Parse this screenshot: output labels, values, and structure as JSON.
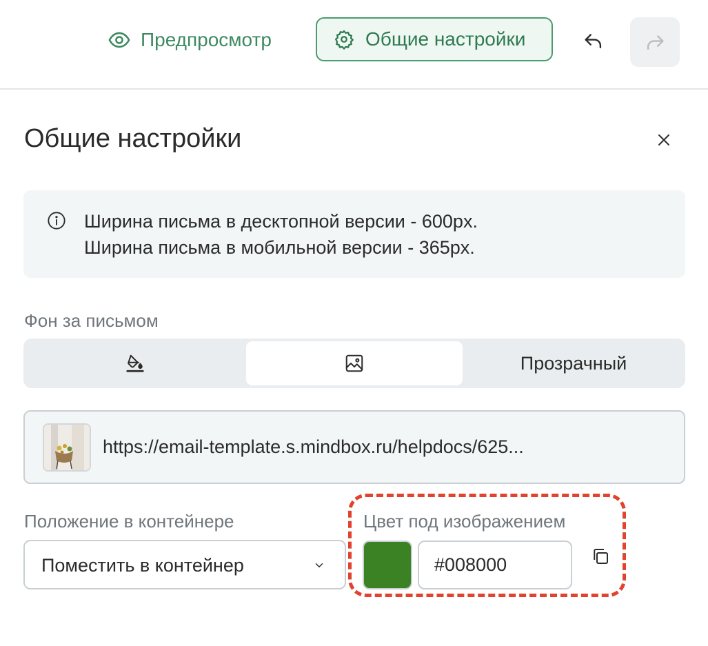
{
  "toolbar": {
    "preview_label": "Предпросмотр",
    "settings_label": "Общие настройки",
    "accent_color": "#3d8a62"
  },
  "panel": {
    "title": "Общие настройки",
    "info": {
      "line1": "Ширина письма в десктопной версии - 600px.",
      "line2": "Ширина письма в мобильной версии - 365px."
    },
    "background": {
      "label": "Фон за письмом",
      "options": [
        {
          "icon": "paint-bucket-icon",
          "label": ""
        },
        {
          "icon": "image-icon",
          "label": "",
          "selected": true
        },
        {
          "icon": "",
          "label": "Прозрачный"
        }
      ]
    },
    "image_url": "https://email-template.s.mindbox.ru/helpdocs/625...",
    "position": {
      "label": "Положение в контейнере",
      "value": "Поместить в контейнер"
    },
    "color": {
      "label": "Цвет под изображением",
      "hex": "#008000",
      "swatch_color": "#3a8224",
      "highlight_color": "#e0432e"
    }
  }
}
